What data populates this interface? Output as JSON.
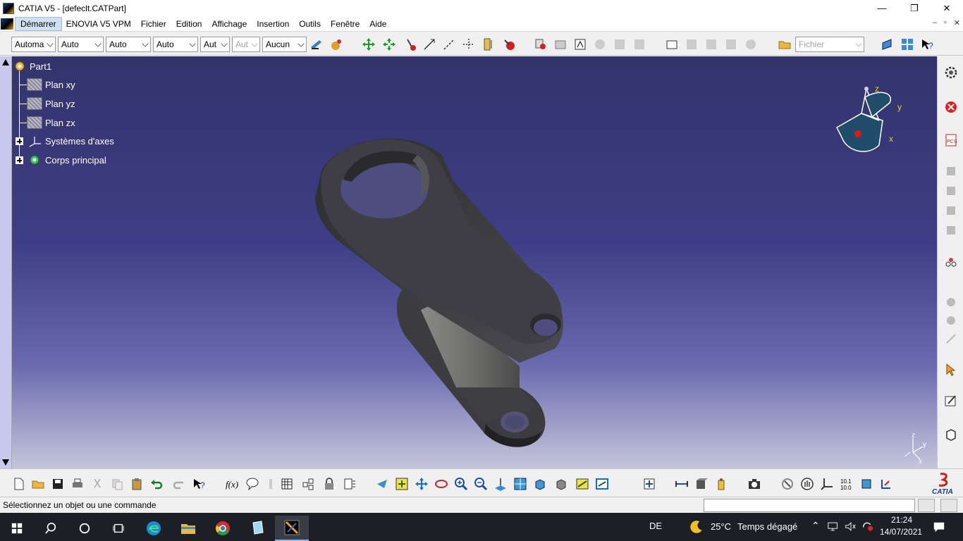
{
  "window": {
    "title": "CATIA V5 - [defeclt.CATPart]",
    "minimize": "—",
    "maximize": "❐",
    "close": "✕"
  },
  "menubar": {
    "items": [
      {
        "label": "Démarrer",
        "active": true
      },
      {
        "label": "ENOVIA V5 VPM"
      },
      {
        "label": "Fichier"
      },
      {
        "label": "Edition"
      },
      {
        "label": "Affichage"
      },
      {
        "label": "Insertion"
      },
      {
        "label": "Outils"
      },
      {
        "label": "Fenêtre"
      },
      {
        "label": "Aide"
      }
    ],
    "mdi": {
      "min": "–",
      "restore": "▫",
      "close": "✕"
    }
  },
  "toolbar_top": {
    "combos": [
      {
        "value": "Automa"
      },
      {
        "value": "Auto"
      },
      {
        "value": "Auto"
      },
      {
        "value": "Auto"
      },
      {
        "value": "Aut"
      },
      {
        "value": "Aut",
        "disabled": true
      },
      {
        "value": "Aucun"
      }
    ],
    "fichier_combo": "Fichier"
  },
  "tree": {
    "root": "Part1",
    "children": [
      {
        "label": "Plan xy",
        "icon": "plane-icon"
      },
      {
        "label": "Plan yz",
        "icon": "plane-icon"
      },
      {
        "label": "Plan zx",
        "icon": "plane-icon"
      },
      {
        "label": "Systèmes d'axes",
        "icon": "axis-system-icon",
        "expandable": true
      },
      {
        "label": "Corps principal",
        "icon": "body-icon",
        "expandable": true
      }
    ]
  },
  "compass": {
    "x": "x",
    "y": "y",
    "z": "z"
  },
  "mini_axes": {
    "x": "x",
    "y": "y",
    "z": "z"
  },
  "statusbar": {
    "message": "Sélectionnez un objet ou une commande"
  },
  "taskbar": {
    "language": "DE",
    "temperature": "25°C",
    "weather": "Temps dégagé",
    "time": "21:24",
    "date": "14/07/2021"
  },
  "colors": {
    "viewport_top": "#33336c",
    "viewport_bottom": "#c5c5dc",
    "part": "#3a3a40"
  }
}
